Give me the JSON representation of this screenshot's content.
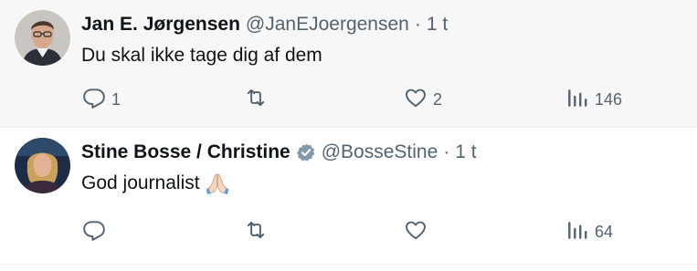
{
  "tweets": [
    {
      "name": "Jan E. Jørgensen",
      "handle": "@JanEJoergensen",
      "dot": "·",
      "time": "1 t",
      "text": "Du skal ikke tage dig af dem",
      "verified": false,
      "replies": "1",
      "retweets": "",
      "likes": "2",
      "views": "146"
    },
    {
      "name": "Stine Bosse / Christine",
      "handle": "@BosseStine",
      "dot": "·",
      "time": "1 t",
      "text": "God journalist",
      "emoji": "folded-hands-emoji",
      "verified": true,
      "replies": "",
      "retweets": "",
      "likes": "",
      "views": "64"
    }
  ],
  "colors": {
    "secondary_text": "#536471",
    "primary_text": "#0f1419",
    "highlight_bg": "#f7f7f7",
    "verified_badge": "#829aab"
  },
  "icons": [
    "reply-icon",
    "retweet-icon",
    "like-icon",
    "views-icon",
    "verified-badge-icon"
  ]
}
